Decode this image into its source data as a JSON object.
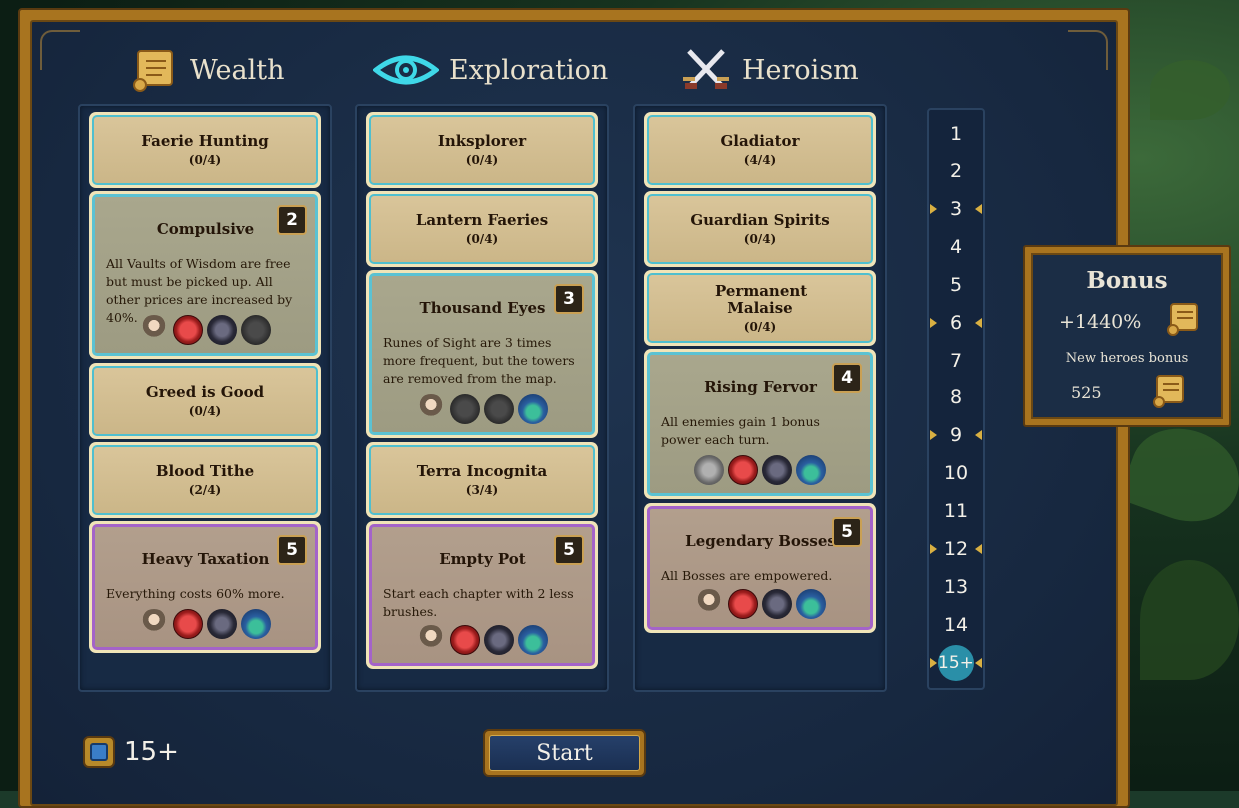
{
  "columns": [
    {
      "name": "Wealth",
      "icon": "scroll-icon",
      "cards": [
        {
          "title": "Faerie Hunting",
          "progress": "(0/4)"
        },
        {
          "title": "Compulsive",
          "level": "2",
          "description": "All Vaults of Wisdom are free but must be picked up. All other prices are increased by 40%.",
          "style": "blue",
          "icons": [
            "hero",
            "red",
            "bug",
            "dark"
          ]
        },
        {
          "title": "Greed is Good",
          "progress": "(0/4)"
        },
        {
          "title": "Blood Tithe",
          "progress": "(2/4)"
        },
        {
          "title": "Heavy Taxation",
          "level": "5",
          "description": "Everything costs 60% more.",
          "style": "purple",
          "icons": [
            "hero",
            "red",
            "bug",
            "shell"
          ]
        }
      ]
    },
    {
      "name": "Exploration",
      "icon": "eye-icon",
      "cards": [
        {
          "title": "Inksplorer",
          "progress": "(0/4)"
        },
        {
          "title": "Lantern Faeries",
          "progress": "(0/4)"
        },
        {
          "title": "Thousand Eyes",
          "level": "3",
          "description": "Runes of Sight are 3 times more frequent, but the towers are removed from the map.",
          "style": "blue",
          "icons": [
            "hero",
            "dark",
            "dark",
            "shell"
          ]
        },
        {
          "title": "Terra Incognita",
          "progress": "(3/4)"
        },
        {
          "title": "Empty Pot",
          "level": "5",
          "description": "Start each chapter with 2 less brushes.",
          "style": "purple",
          "icons": [
            "hero",
            "red",
            "bug",
            "shell"
          ]
        }
      ]
    },
    {
      "name": "Heroism",
      "icon": "crossed-swords-icon",
      "cards": [
        {
          "title": "Gladiator",
          "progress": "(4/4)"
        },
        {
          "title": "Guardian Spirits",
          "progress": "(0/4)"
        },
        {
          "title": "Permanent Malaise",
          "progress": "(0/4)"
        },
        {
          "title": "Rising Fervor",
          "level": "4",
          "description": "All enemies gain 1 bonus power each turn.",
          "style": "blue",
          "icons": [
            "grey",
            "red",
            "bug",
            "shell"
          ]
        },
        {
          "title": "Legendary Bosses",
          "level": "5",
          "description": "All Bosses are empowered.",
          "style": "purple",
          "icons": [
            "hero",
            "red",
            "bug",
            "shell"
          ]
        }
      ]
    }
  ],
  "levels": [
    "1",
    "2",
    "3",
    "4",
    "5",
    "6",
    "7",
    "8",
    "9",
    "10",
    "11",
    "12",
    "13",
    "14",
    "15+"
  ],
  "level_markers": [
    "3",
    "6",
    "9",
    "12",
    "15+"
  ],
  "selected_level": "15+",
  "bonus": {
    "title": "Bonus",
    "percent": "+1440%",
    "new_heroes_label": "New heroes bonus",
    "new_heroes_value": "525"
  },
  "footer": {
    "difficulty": "15+",
    "start_label": "Start"
  },
  "colors": {
    "frame_gold": "#a8741f",
    "panel_navy": "#1b2d45",
    "card_blue_border": "#5bc2d3",
    "card_purple_border": "#a463c9",
    "level_selected": "#2a8fa8",
    "marker_gold": "#d9b042"
  }
}
